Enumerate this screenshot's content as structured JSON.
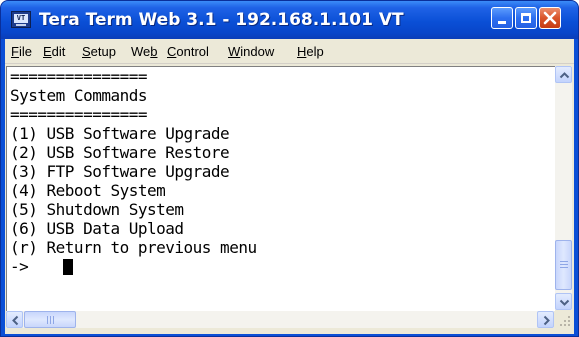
{
  "window": {
    "title": "Tera Term Web 3.1 - 192.168.1.101 VT",
    "app_icon_text": "VT",
    "colors": {
      "titlebar": "#0a4fd6",
      "close_button": "#d9542a",
      "frame": "#ece9d8"
    }
  },
  "menubar": {
    "items": [
      {
        "pre": "",
        "key": "F",
        "post": "ile"
      },
      {
        "pre": "",
        "key": "E",
        "post": "dit"
      },
      {
        "pre": "",
        "key": "S",
        "post": "etup"
      },
      {
        "pre": "We",
        "key": "b",
        "post": ""
      },
      {
        "pre": "",
        "key": "C",
        "post": "ontrol"
      },
      {
        "pre": "",
        "key": "W",
        "post": "indow"
      },
      {
        "pre": "",
        "key": "H",
        "post": "elp"
      }
    ]
  },
  "terminal": {
    "lines": [
      "===============",
      "System Commands",
      "===============",
      "(1) USB Software Upgrade",
      "(2) USB Software Restore",
      "(3) FTP Software Upgrade",
      "(4) Reboot System",
      "(5) Shutdown System",
      "(6) USB Data Upload",
      "(r) Return to previous menu",
      "->"
    ]
  },
  "icons": {
    "minimize": "minimize-icon",
    "maximize": "maximize-icon",
    "close": "close-icon",
    "scroll_up": "arrow-up-icon",
    "scroll_down": "arrow-down-icon",
    "scroll_left": "arrow-left-icon",
    "scroll_right": "arrow-right-icon"
  }
}
